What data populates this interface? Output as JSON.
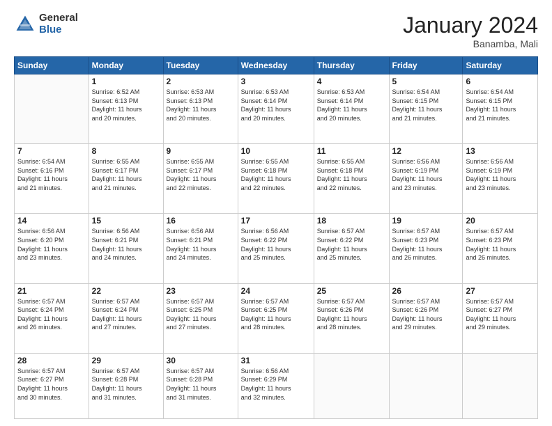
{
  "logo": {
    "general": "General",
    "blue": "Blue"
  },
  "header": {
    "title": "January 2024",
    "subtitle": "Banamba, Mali"
  },
  "weekdays": [
    "Sunday",
    "Monday",
    "Tuesday",
    "Wednesday",
    "Thursday",
    "Friday",
    "Saturday"
  ],
  "weeks": [
    [
      {
        "day": "",
        "info": ""
      },
      {
        "day": "1",
        "info": "Sunrise: 6:52 AM\nSunset: 6:13 PM\nDaylight: 11 hours\nand 20 minutes."
      },
      {
        "day": "2",
        "info": "Sunrise: 6:53 AM\nSunset: 6:13 PM\nDaylight: 11 hours\nand 20 minutes."
      },
      {
        "day": "3",
        "info": "Sunrise: 6:53 AM\nSunset: 6:14 PM\nDaylight: 11 hours\nand 20 minutes."
      },
      {
        "day": "4",
        "info": "Sunrise: 6:53 AM\nSunset: 6:14 PM\nDaylight: 11 hours\nand 20 minutes."
      },
      {
        "day": "5",
        "info": "Sunrise: 6:54 AM\nSunset: 6:15 PM\nDaylight: 11 hours\nand 21 minutes."
      },
      {
        "day": "6",
        "info": "Sunrise: 6:54 AM\nSunset: 6:15 PM\nDaylight: 11 hours\nand 21 minutes."
      }
    ],
    [
      {
        "day": "7",
        "info": "Sunrise: 6:54 AM\nSunset: 6:16 PM\nDaylight: 11 hours\nand 21 minutes."
      },
      {
        "day": "8",
        "info": "Sunrise: 6:55 AM\nSunset: 6:17 PM\nDaylight: 11 hours\nand 21 minutes."
      },
      {
        "day": "9",
        "info": "Sunrise: 6:55 AM\nSunset: 6:17 PM\nDaylight: 11 hours\nand 22 minutes."
      },
      {
        "day": "10",
        "info": "Sunrise: 6:55 AM\nSunset: 6:18 PM\nDaylight: 11 hours\nand 22 minutes."
      },
      {
        "day": "11",
        "info": "Sunrise: 6:55 AM\nSunset: 6:18 PM\nDaylight: 11 hours\nand 22 minutes."
      },
      {
        "day": "12",
        "info": "Sunrise: 6:56 AM\nSunset: 6:19 PM\nDaylight: 11 hours\nand 23 minutes."
      },
      {
        "day": "13",
        "info": "Sunrise: 6:56 AM\nSunset: 6:19 PM\nDaylight: 11 hours\nand 23 minutes."
      }
    ],
    [
      {
        "day": "14",
        "info": "Sunrise: 6:56 AM\nSunset: 6:20 PM\nDaylight: 11 hours\nand 23 minutes."
      },
      {
        "day": "15",
        "info": "Sunrise: 6:56 AM\nSunset: 6:21 PM\nDaylight: 11 hours\nand 24 minutes."
      },
      {
        "day": "16",
        "info": "Sunrise: 6:56 AM\nSunset: 6:21 PM\nDaylight: 11 hours\nand 24 minutes."
      },
      {
        "day": "17",
        "info": "Sunrise: 6:56 AM\nSunset: 6:22 PM\nDaylight: 11 hours\nand 25 minutes."
      },
      {
        "day": "18",
        "info": "Sunrise: 6:57 AM\nSunset: 6:22 PM\nDaylight: 11 hours\nand 25 minutes."
      },
      {
        "day": "19",
        "info": "Sunrise: 6:57 AM\nSunset: 6:23 PM\nDaylight: 11 hours\nand 26 minutes."
      },
      {
        "day": "20",
        "info": "Sunrise: 6:57 AM\nSunset: 6:23 PM\nDaylight: 11 hours\nand 26 minutes."
      }
    ],
    [
      {
        "day": "21",
        "info": "Sunrise: 6:57 AM\nSunset: 6:24 PM\nDaylight: 11 hours\nand 26 minutes."
      },
      {
        "day": "22",
        "info": "Sunrise: 6:57 AM\nSunset: 6:24 PM\nDaylight: 11 hours\nand 27 minutes."
      },
      {
        "day": "23",
        "info": "Sunrise: 6:57 AM\nSunset: 6:25 PM\nDaylight: 11 hours\nand 27 minutes."
      },
      {
        "day": "24",
        "info": "Sunrise: 6:57 AM\nSunset: 6:25 PM\nDaylight: 11 hours\nand 28 minutes."
      },
      {
        "day": "25",
        "info": "Sunrise: 6:57 AM\nSunset: 6:26 PM\nDaylight: 11 hours\nand 28 minutes."
      },
      {
        "day": "26",
        "info": "Sunrise: 6:57 AM\nSunset: 6:26 PM\nDaylight: 11 hours\nand 29 minutes."
      },
      {
        "day": "27",
        "info": "Sunrise: 6:57 AM\nSunset: 6:27 PM\nDaylight: 11 hours\nand 29 minutes."
      }
    ],
    [
      {
        "day": "28",
        "info": "Sunrise: 6:57 AM\nSunset: 6:27 PM\nDaylight: 11 hours\nand 30 minutes."
      },
      {
        "day": "29",
        "info": "Sunrise: 6:57 AM\nSunset: 6:28 PM\nDaylight: 11 hours\nand 31 minutes."
      },
      {
        "day": "30",
        "info": "Sunrise: 6:57 AM\nSunset: 6:28 PM\nDaylight: 11 hours\nand 31 minutes."
      },
      {
        "day": "31",
        "info": "Sunrise: 6:56 AM\nSunset: 6:29 PM\nDaylight: 11 hours\nand 32 minutes."
      },
      {
        "day": "",
        "info": ""
      },
      {
        "day": "",
        "info": ""
      },
      {
        "day": "",
        "info": ""
      }
    ]
  ]
}
